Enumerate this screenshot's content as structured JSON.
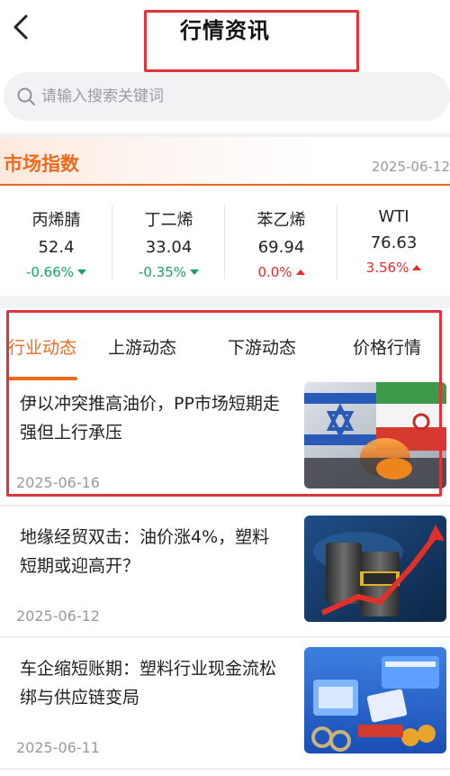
{
  "header": {
    "title": "行情资讯"
  },
  "search": {
    "placeholder": "请输入搜索关键词"
  },
  "market": {
    "title": "市场指数",
    "date": "2025-06-12",
    "indices": [
      {
        "name": "丙烯腈",
        "value": "52.4",
        "change": "-0.66%",
        "direction": "down"
      },
      {
        "name": "丁二烯",
        "value": "33.04",
        "change": "-0.35%",
        "direction": "down"
      },
      {
        "name": "苯乙烯",
        "value": "69.94",
        "change": "0.0%",
        "direction": "up"
      },
      {
        "name": "WTI",
        "value": "76.63",
        "change": "3.56%",
        "direction": "up"
      }
    ]
  },
  "tabs": [
    {
      "label": "行业动态",
      "active": true
    },
    {
      "label": "上游动态",
      "active": false
    },
    {
      "label": "下游动态",
      "active": false
    },
    {
      "label": "价格行情",
      "active": false
    }
  ],
  "news": [
    {
      "title": "伊以冲突推高油价，PP市场短期走强但上行承压",
      "date": "2025-06-16",
      "thumb": "israel-iran-flags-image"
    },
    {
      "title": "地缘经贸双击：油价涨4%，塑料短期或迎高开？",
      "date": "2025-06-12",
      "thumb": "oil-barrels-chart-image"
    },
    {
      "title": "车企缩短账期：塑料行业现金流松绑与供应链变局",
      "date": "2025-06-11",
      "thumb": "auto-payment-60-days-image"
    }
  ],
  "colors": {
    "accent": "#f06a1e",
    "up": "#e52b2b",
    "down": "#1aa260",
    "highlight_box": "#e0343a"
  }
}
